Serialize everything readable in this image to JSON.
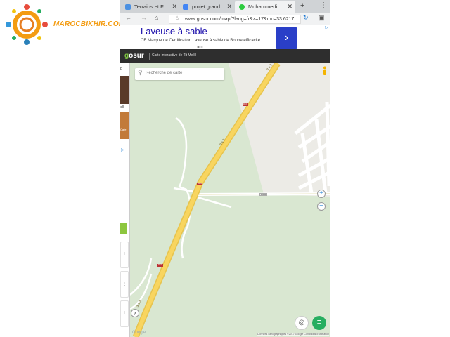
{
  "watermark": {
    "text": "MAROCBIKHIR.COM"
  },
  "browser": {
    "tabs": [
      {
        "label": "Terrains et F...",
        "icon": "maps-pin-icon"
      },
      {
        "label": "projet grand...",
        "icon": "document-icon"
      },
      {
        "label": "Mohammedi...",
        "icon": "leaf-icon"
      }
    ],
    "new_tab": "+",
    "url": "www.gosur.com/map/?lang=fr&z=17&mc=33.6217"
  },
  "ad": {
    "title": "Laveuse à sable",
    "description": "CE Marque de Certification Laveuse à sable de Bonne efficacité"
  },
  "map_header": {
    "logo_prefix": "g",
    "logo_rest": "osur",
    "caption": "Carte interactive de Tit Mellil"
  },
  "map": {
    "search_placeholder": "Recherche de carte",
    "road_labels": [
      "3 a 3",
      "3 a 3",
      "3 a 3"
    ],
    "road_shields": [
      "R315",
      "R315",
      "R315",
      "P3014"
    ],
    "google_label": "Google",
    "attribution": "Données cartographiques ©2017 Google   Conditions d'utilisation"
  },
  "sidebar": {
    "letters": [
      "ip",
      "tell",
      "Cafe"
    ]
  }
}
